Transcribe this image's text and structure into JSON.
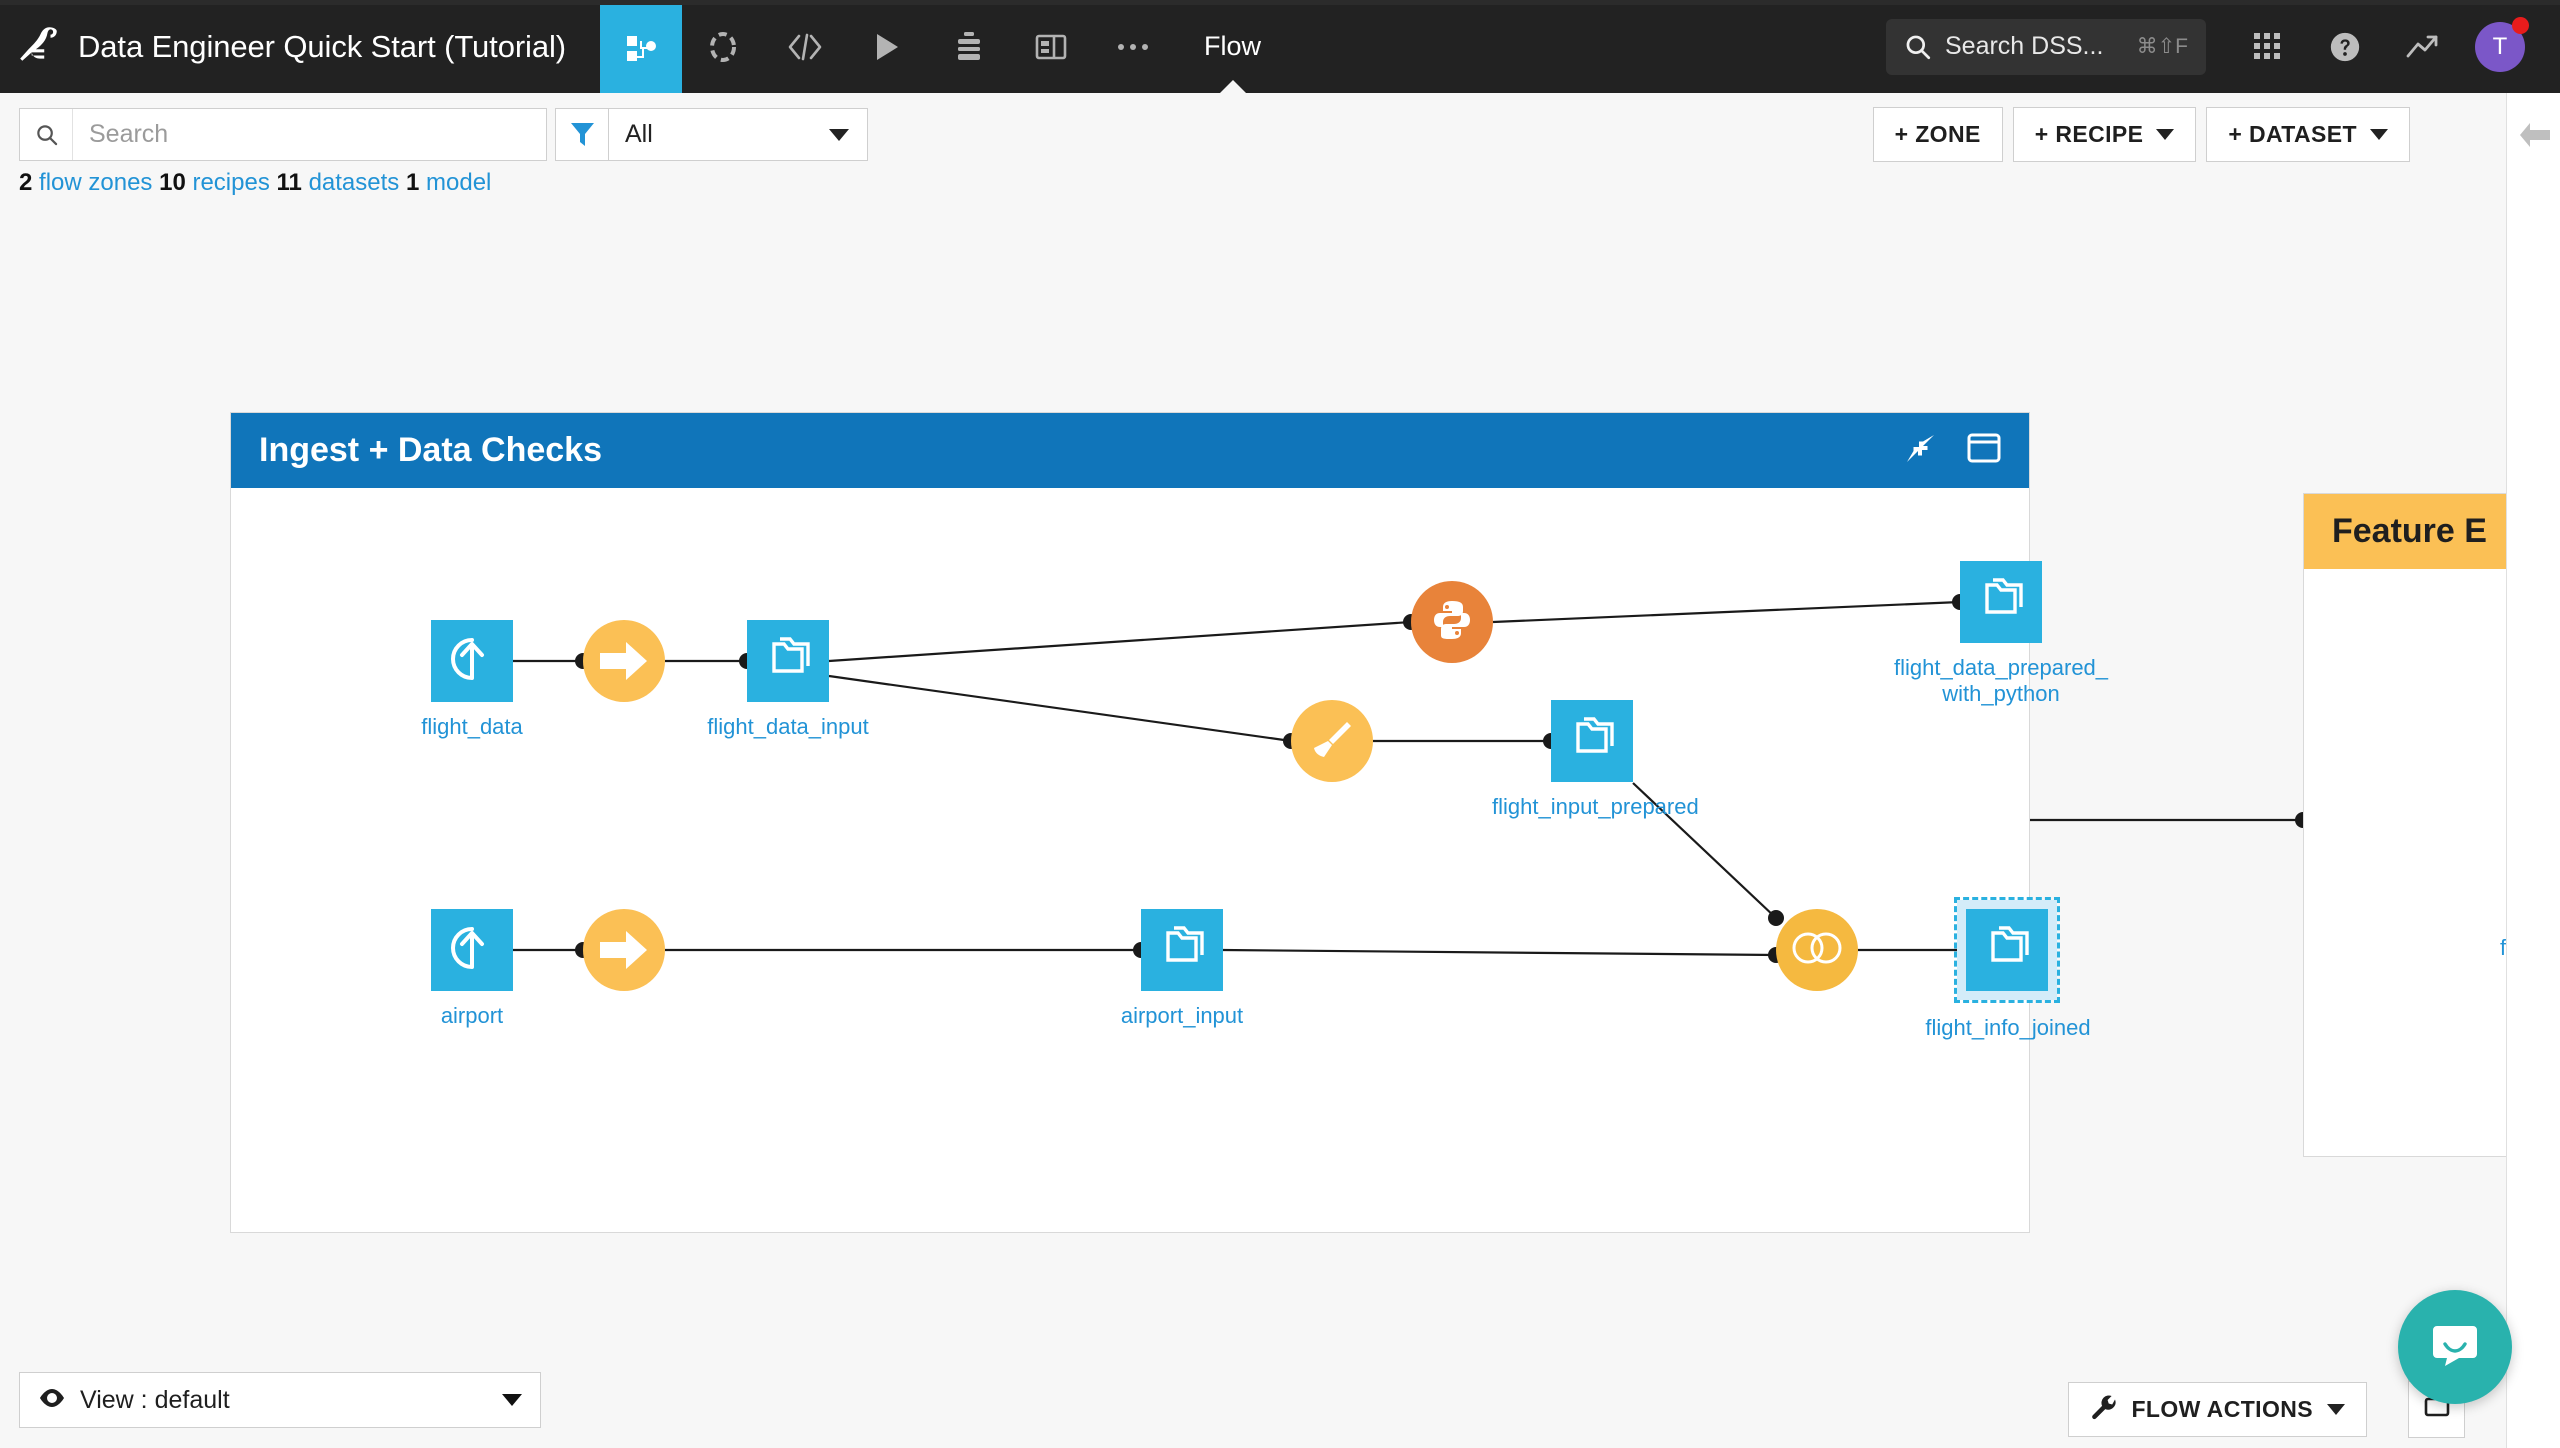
{
  "topbar": {
    "logo_icon": "dataiku-bird-logo",
    "project_title": "Data Engineer Quick Start (Tutorial)",
    "nav_icons": [
      {
        "name": "flow-icon",
        "active": true
      },
      {
        "name": "dataset-circle-icon",
        "active": false
      },
      {
        "name": "code-icon",
        "active": false
      },
      {
        "name": "run-play-icon",
        "active": false
      },
      {
        "name": "jobs-stack-icon",
        "active": false
      },
      {
        "name": "dashboard-icon",
        "active": false
      },
      {
        "name": "more-ellipsis-icon",
        "active": false
      }
    ],
    "active_nav_label": "Flow",
    "search": {
      "text": "Search DSS...",
      "shortcut": "⌘⇧F",
      "icon": "search-icon"
    },
    "apps_icon": "apps-grid-icon",
    "help_icon": "help-question-icon",
    "activity_icon": "trend-arrow-icon",
    "avatar_initial": "T",
    "avatar_color": "#7b57c8",
    "notification_color": "#e81c1c"
  },
  "toolbar": {
    "search_placeholder": "Search",
    "search_value": "",
    "filter_icon": "filter-funnel-icon",
    "filter_value": "All",
    "stats": {
      "zones_count": "2",
      "zones_label": "flow zones",
      "recipes_count": "10",
      "recipes_label": "recipes",
      "datasets_count": "11",
      "datasets_label": "datasets",
      "models_count": "1",
      "models_label": "model"
    },
    "zone_button": "+ ZONE",
    "recipe_button": "+ RECIPE",
    "dataset_button": "+ DATASET",
    "collapse_panel_icon": "arrow-left-icon"
  },
  "flow": {
    "zones": [
      {
        "title": "Ingest + Data Checks",
        "header_color": "#1075ba",
        "collapse_icon": "collapse-arrows-icon",
        "window_icon": "zone-window-icon"
      },
      {
        "title": "Feature E",
        "header_color": "#fbc055"
      }
    ],
    "datasets": [
      {
        "id": "flight_data",
        "label": "flight_data",
        "icon": "upload-dataset-icon",
        "selected": false
      },
      {
        "id": "flight_data_input",
        "label": "flight_data_input",
        "icon": "folder-dataset-icon",
        "selected": false
      },
      {
        "id": "flight_data_prepared_with_python",
        "label": "flight_data_prepared_​with_python",
        "icon": "folder-dataset-icon",
        "selected": false
      },
      {
        "id": "flight_input_prepared",
        "label": "flight_input_prepared",
        "icon": "folder-dataset-icon",
        "selected": false
      },
      {
        "id": "airport",
        "label": "airport",
        "icon": "upload-dataset-icon",
        "selected": false
      },
      {
        "id": "airport_input",
        "label": "airport_input",
        "icon": "folder-dataset-icon",
        "selected": false
      },
      {
        "id": "flight_info_joined",
        "label": "flight_info_joined",
        "icon": "folder-dataset-icon",
        "selected": true
      }
    ],
    "dataset_label_line1": "flight_data_prepared_",
    "dataset_label_line2": "with_python",
    "recipes": [
      {
        "id": "sync_flight",
        "type": "sync",
        "icon": "sync-arrow-icon",
        "color": "#fbc055"
      },
      {
        "id": "python_rec",
        "type": "python",
        "icon": "python-icon",
        "color": "#e8833a"
      },
      {
        "id": "prepare_rec",
        "type": "prepare",
        "icon": "broom-prepare-icon",
        "color": "#fbc055"
      },
      {
        "id": "sync_airport",
        "type": "sync",
        "icon": "sync-arrow-icon",
        "color": "#fbc055"
      },
      {
        "id": "join_rec",
        "type": "join",
        "icon": "join-venn-icon",
        "color": "#f5b940"
      }
    ],
    "zone2_node_label": "flight",
    "node_color": "#2ab1e0",
    "label_color": "#2293d6"
  },
  "bottombar": {
    "view_icon": "eye-icon",
    "view_label": "View : default",
    "flow_actions_icon": "wrench-icon",
    "flow_actions_label": "FLOW ACTIONS",
    "zoom_fit_icon": "expand-arrows-icon",
    "zoom_reset_icon": "zoom-reset-icon",
    "chat_icon": "intercom-chat-icon",
    "chat_color": "#29b2ad"
  }
}
